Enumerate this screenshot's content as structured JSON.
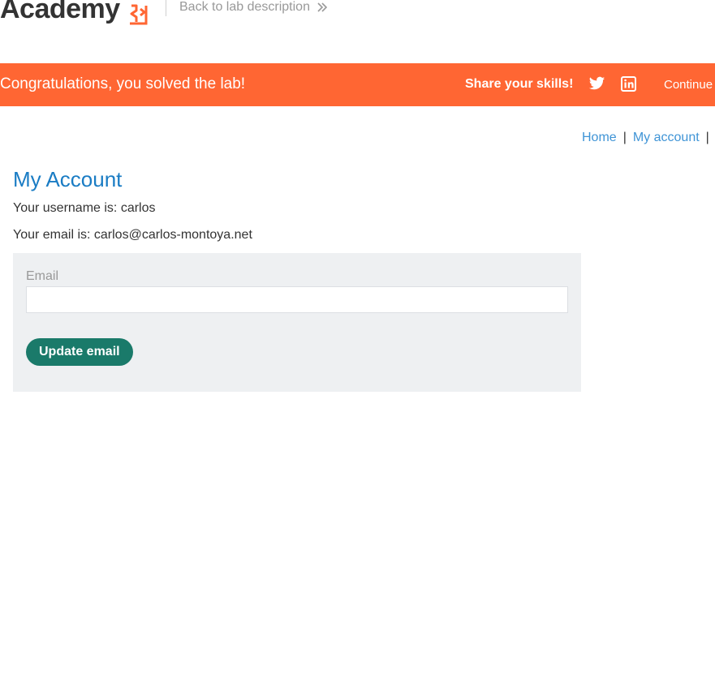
{
  "header": {
    "logo_text": "Academy",
    "back_link": "Back to lab description"
  },
  "banner": {
    "message": "Congratulations, you solved the lab!",
    "share_label": "Share your skills!",
    "continue_label": "Continue"
  },
  "nav": {
    "home": "Home",
    "separator": "|",
    "my_account": "My account",
    "separator_trailing": "|"
  },
  "account": {
    "title": "My Account",
    "username_line": "Your username is: carlos",
    "email_line": "Your email is: carlos@carlos-montoya.net"
  },
  "form": {
    "email_label": "Email",
    "email_value": "",
    "submit_label": "Update email"
  },
  "colors": {
    "banner": "#ff6633",
    "link": "#3f94d6",
    "title": "#1a7cc4",
    "button": "#1a7a6a",
    "form_bg": "#eef0f2"
  },
  "icons": {
    "logo_mark": "academy-logo-mark-icon",
    "back": "double-chevron-right-icon",
    "twitter": "twitter-icon",
    "linkedin": "linkedin-icon"
  }
}
